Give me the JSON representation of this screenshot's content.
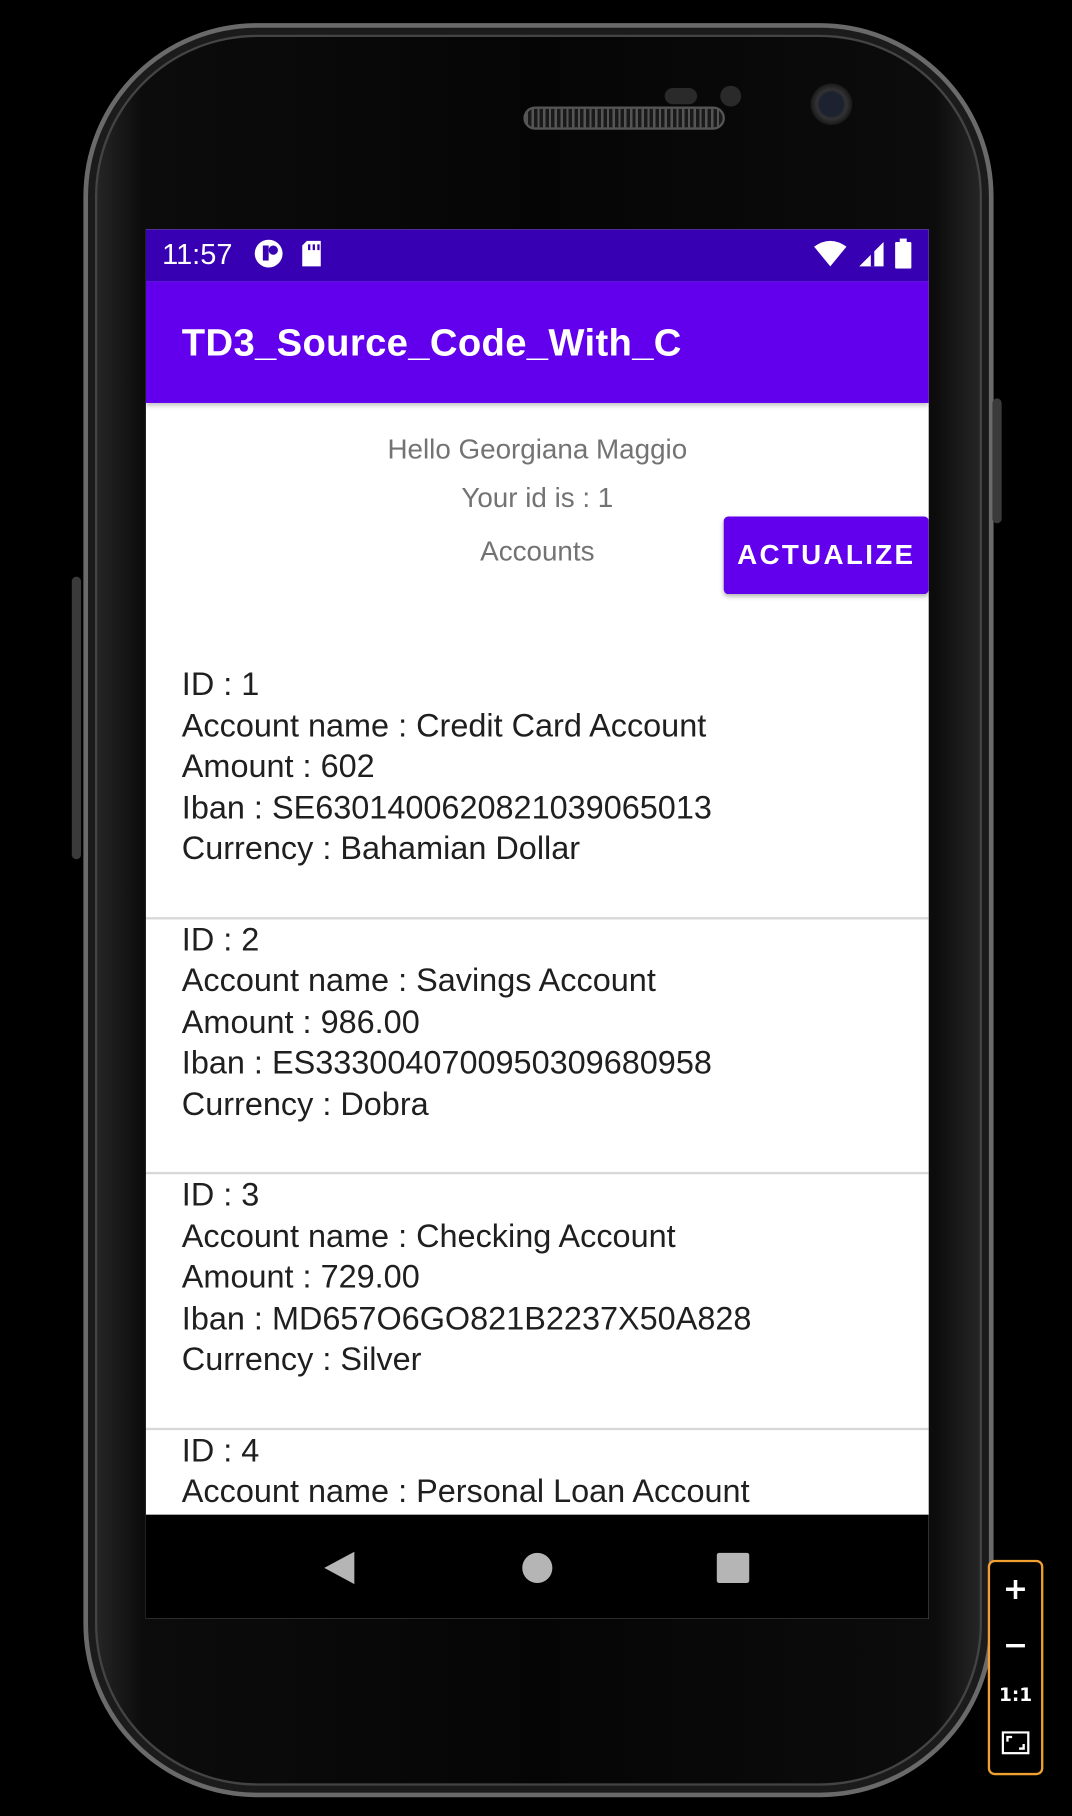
{
  "status_bar": {
    "time": "11:57"
  },
  "app_bar": {
    "title": "TD3_Source_Code_With_C"
  },
  "header": {
    "greeting": "Hello Georgiana Maggio",
    "id_text": "Your id is : 1",
    "accounts_label": "Accounts",
    "actualize_button": "ACTUALIZE"
  },
  "accounts": [
    {
      "id": "ID : 1",
      "name": "Account name : Credit Card Account",
      "amount": "Amount : 602",
      "iban": "Iban : SE6301400620821039065013",
      "currency": "Currency : Bahamian Dollar"
    },
    {
      "id": "ID : 2",
      "name": "Account name : Savings Account",
      "amount": "Amount : 986.00",
      "iban": "Iban : ES3330040700950309680958",
      "currency": "Currency : Dobra"
    },
    {
      "id": "ID : 3",
      "name": "Account name : Checking Account",
      "amount": "Amount : 729.00",
      "iban": "Iban : MD657O6GO821B2237X50A828",
      "currency": "Currency : Silver"
    },
    {
      "id": "ID : 4",
      "name": "Account name : Personal Loan Account",
      "amount": "",
      "iban": "",
      "currency": ""
    }
  ],
  "zoom_controls": {
    "zoom_in": "+",
    "zoom_out": "−",
    "actual_size": "1:1"
  },
  "colors": {
    "status_bar": "#3700b3",
    "app_bar": "#6200ee",
    "button": "#6200ee",
    "zoom_border": "#f0a030"
  }
}
